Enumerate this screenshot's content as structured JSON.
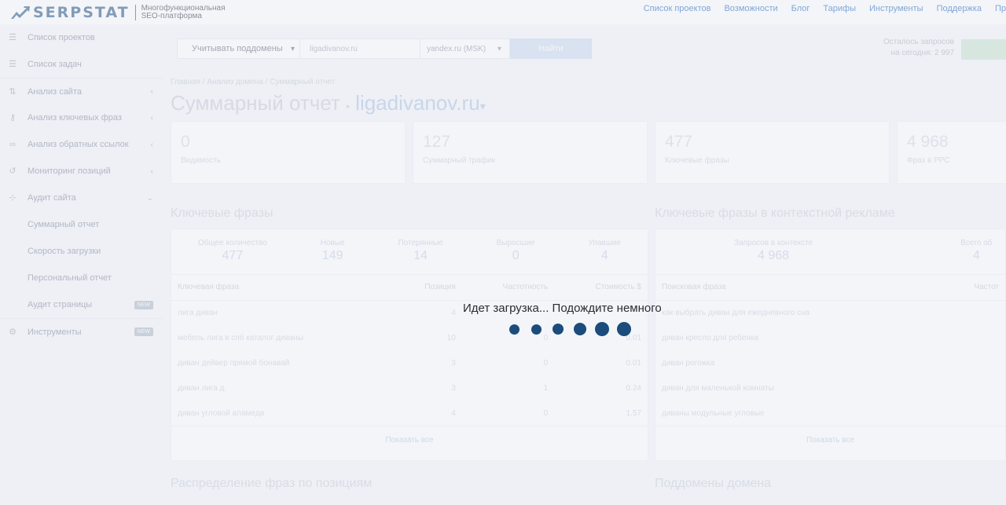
{
  "header": {
    "logo_text": "SERPSTAT",
    "tagline_line1": "Многофункциональная",
    "tagline_line2": "SEO-платформа",
    "nav": [
      "Список проектов",
      "Возможности",
      "Блог",
      "Тарифы",
      "Инструменты",
      "Поддержка",
      "Пр"
    ]
  },
  "sidebar": {
    "items": [
      {
        "label": "Список проектов",
        "icon": "list-icon"
      },
      {
        "label": "Список задач",
        "icon": "list-icon"
      },
      {
        "label": "Анализ сайта",
        "icon": "site-analysis-icon"
      },
      {
        "label": "Анализ ключевых фраз",
        "icon": "key-icon"
      },
      {
        "label": "Анализ обратных ссылок",
        "icon": "link-icon"
      },
      {
        "label": "Мониторинг позиций",
        "icon": "history-icon"
      },
      {
        "label": "Аудит сайта",
        "icon": "sitemap-icon"
      }
    ],
    "sub_items": [
      "Суммарный отчет",
      "Скорость загрузки",
      "Персональный отчет",
      "Аудит страницы"
    ],
    "tools_label": "Инструменты",
    "badge_new": "NEW"
  },
  "search": {
    "subdomain_select": "Учитывать поддомены",
    "domain_value": "ligadivanov.ru",
    "database_select": "yandex.ru (MSK)",
    "find_button": "Найти"
  },
  "quota": {
    "line1": "Осталось запросов",
    "line2": "на сегодня: 2 997"
  },
  "breadcrumbs": "Главная / Анализ домена / Суммарный отчет",
  "page": {
    "title": "Суммарный отчет",
    "domain": "ligadivanov.ru"
  },
  "cards": [
    {
      "value": "0",
      "label": "Видимость"
    },
    {
      "value": "127",
      "label": "Суммарный трафик"
    },
    {
      "value": "477",
      "label": "Ключевые фразы"
    },
    {
      "value": "4 968",
      "label": "Фраз в PPC"
    }
  ],
  "keywords_section": {
    "title": "Ключевые фразы",
    "stats": [
      {
        "label": "Общее количество",
        "value": "477"
      },
      {
        "label": "Новые",
        "value": "149"
      },
      {
        "label": "Потерянные",
        "value": "14"
      },
      {
        "label": "Выросшие",
        "value": "0"
      },
      {
        "label": "Упавшие",
        "value": "4"
      }
    ],
    "columns": [
      "Ключевая фраза",
      "Позиция",
      "Частотность",
      "Стоимость $"
    ],
    "rows": [
      [
        "лига диван",
        "4",
        "",
        ""
      ],
      [
        "мебель лига в спб каталог диваны",
        "10",
        "0",
        "0.01"
      ],
      [
        "диван дейвер прямой бонавай",
        "3",
        "0",
        "0.01"
      ],
      [
        "диван лига д",
        "3",
        "1",
        "0.24"
      ],
      [
        "диван угловой аламеда",
        "4",
        "0",
        "1.57"
      ]
    ],
    "show_all": "Показать все"
  },
  "ppc_section": {
    "title": "Ключевые фразы в контекстной рекламе",
    "stats": [
      {
        "label": "Запросов в контексте",
        "value": "4 968"
      },
      {
        "label": "Всего об",
        "value": "4"
      }
    ],
    "columns": [
      "Поисковая фраза",
      "Частот"
    ],
    "rows": [
      "как выбрать диван для ежедневного сна",
      "диван кресло для ребенка",
      "диван рогожка",
      "диван для маленькой комнаты",
      "диваны модульные угловые"
    ],
    "show_all": "Показать все"
  },
  "bottom_titles": {
    "left": "Распределение фраз по позициям",
    "right": "Поддомены домена"
  },
  "loader": {
    "text": "Идет загрузка... Подождите немного",
    "dot_color": "#1b4c7c"
  }
}
